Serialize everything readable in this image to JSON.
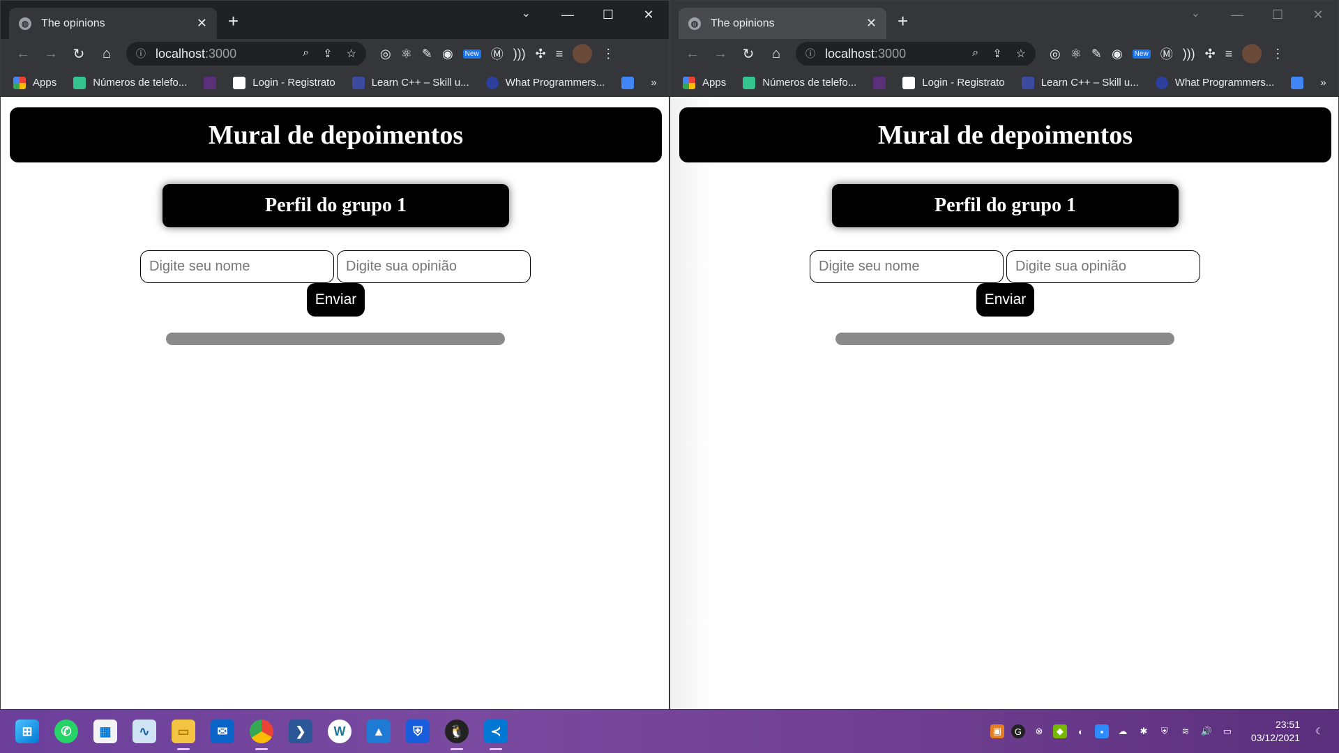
{
  "browser": {
    "tab_title": "The opinions",
    "address_host": "localhost",
    "address_port": ":3000",
    "new_badge": "New",
    "bookmarks": [
      {
        "label": "Apps",
        "color": "#ea4335"
      },
      {
        "label": "Números de telefo...",
        "color": "#34c38f"
      },
      {
        "label": "",
        "color": "#5b2f7a"
      },
      {
        "label": "Login - Registrato",
        "color": "#ffffff"
      },
      {
        "label": "Learn C++ – Skill u...",
        "color": "#3c4aa0"
      },
      {
        "label": "What Programmers...",
        "color": "#2c3e9e"
      },
      {
        "label": "",
        "color": "#4285f4"
      }
    ],
    "bookmarks_more": "»"
  },
  "page": {
    "banner_title": "Mural de depoimentos",
    "profile_title": "Perfil do grupo 1",
    "name_placeholder": "Digite seu nome",
    "opinion_placeholder": "Digite sua opinião",
    "send_label": "Enviar"
  },
  "taskbar": {
    "apps": [
      "windows-start",
      "whatsapp",
      "microsoft-store",
      "task-manager",
      "file-explorer",
      "mail",
      "chrome",
      "powershell",
      "wordpress",
      "photos",
      "bitwarden",
      "linux-penguin",
      "vscode"
    ],
    "time": "23:51",
    "date": "03/12/2021"
  }
}
